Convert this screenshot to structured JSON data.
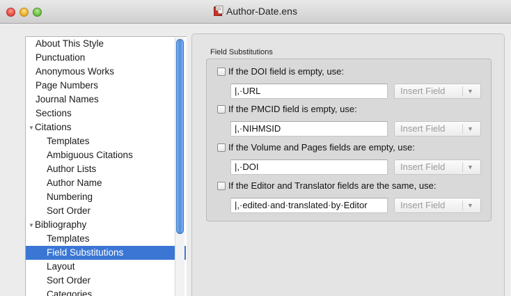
{
  "window": {
    "title": "Author-Date.ens",
    "title_icon": "endnote-document-icon"
  },
  "sidebar": {
    "items": [
      {
        "label": "About This Style",
        "level": 0
      },
      {
        "label": "Punctuation",
        "level": 0
      },
      {
        "label": "Anonymous Works",
        "level": 0
      },
      {
        "label": "Page Numbers",
        "level": 0
      },
      {
        "label": "Journal Names",
        "level": 0
      },
      {
        "label": "Sections",
        "level": 0
      },
      {
        "label": "Citations",
        "level": 0,
        "expanded": true
      },
      {
        "label": "Templates",
        "level": 1
      },
      {
        "label": "Ambiguous Citations",
        "level": 1
      },
      {
        "label": "Author Lists",
        "level": 1
      },
      {
        "label": "Author Name",
        "level": 1
      },
      {
        "label": "Numbering",
        "level": 1
      },
      {
        "label": "Sort Order",
        "level": 1
      },
      {
        "label": "Bibliography",
        "level": 0,
        "expanded": true
      },
      {
        "label": "Templates",
        "level": 1
      },
      {
        "label": "Field Substitutions",
        "level": 1,
        "selected": true
      },
      {
        "label": "Layout",
        "level": 1
      },
      {
        "label": "Sort Order",
        "level": 1
      },
      {
        "label": "Categories",
        "level": 1
      }
    ]
  },
  "main": {
    "section_title": "Field Substitutions",
    "substitutions": [
      {
        "label": "If the DOI field is empty, use:",
        "checked": false,
        "value": "|,·URL",
        "button": "Insert Field"
      },
      {
        "label": "If the PMCID field is empty, use:",
        "checked": false,
        "value": "|,·NIHMSID",
        "button": "Insert Field"
      },
      {
        "label": "If the Volume and Pages fields are empty, use:",
        "checked": false,
        "value": "|,·DOI",
        "button": "Insert Field"
      },
      {
        "label": "If the Editor and Translator fields are the same, use:",
        "checked": false,
        "value": "|,·edited·and·translated·by·Editor",
        "button": "Insert Field"
      }
    ]
  },
  "colors": {
    "selection": "#3b76d5",
    "scroll_thumb": "#4e8ee0"
  }
}
